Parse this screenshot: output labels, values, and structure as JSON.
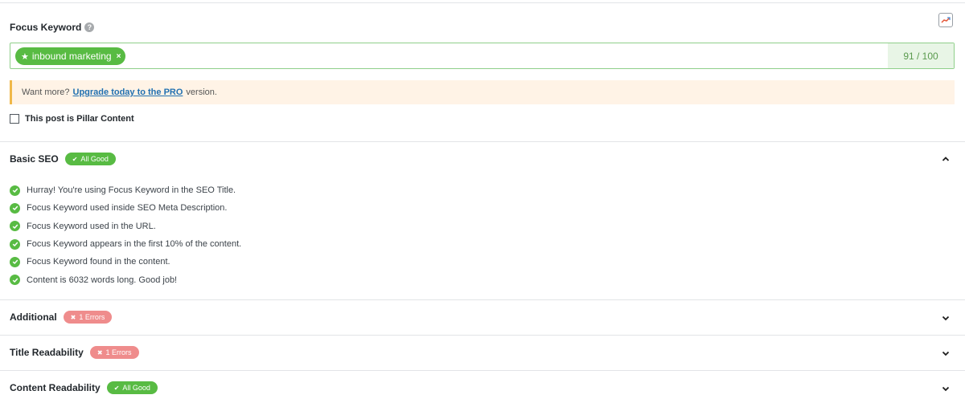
{
  "focus_keyword": {
    "label": "Focus Keyword",
    "help_icon": "?",
    "keyword_tag": "inbound marketing",
    "tag_remove": "×",
    "score": "91 / 100"
  },
  "notice": {
    "prefix": "Want more?",
    "link": "Upgrade today to the PRO",
    "suffix": "version."
  },
  "pillar": {
    "label": "This post is Pillar Content",
    "checked": false
  },
  "sections": [
    {
      "title": "Basic SEO",
      "badge_icon": "✔",
      "badge": "All Good",
      "status": "good",
      "expanded": true
    },
    {
      "title": "Additional",
      "badge_icon": "✖",
      "badge": "1 Errors",
      "status": "error",
      "expanded": false
    },
    {
      "title": "Title Readability",
      "badge_icon": "✖",
      "badge": "1 Errors",
      "status": "error",
      "expanded": false
    },
    {
      "title": "Content Readability",
      "badge_icon": "✔",
      "badge": "All Good",
      "status": "good",
      "expanded": false
    }
  ],
  "basic_seo_checks": [
    "Hurray! You're using Focus Keyword in the SEO Title.",
    "Focus Keyword used inside SEO Meta Description.",
    "Focus Keyword used in the URL.",
    "Focus Keyword appears in the first 10% of the content.",
    "Focus Keyword found in the content.",
    "Content is 6032 words long. Good job!"
  ],
  "colors": {
    "good_green": "#58bb43",
    "error_red": "#ef8c8c",
    "notice_bg": "#fff3e6",
    "notice_border": "#f0b849",
    "link_blue": "#2271b1"
  }
}
